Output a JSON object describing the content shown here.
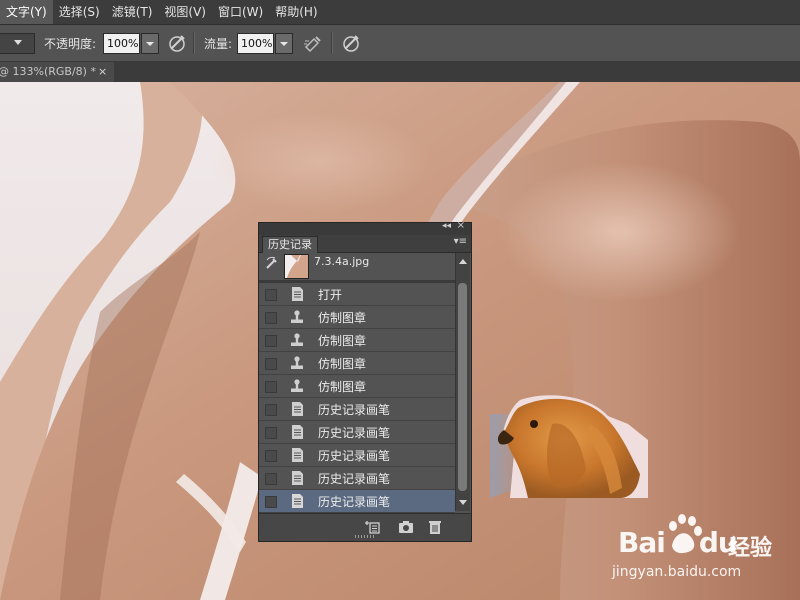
{
  "menubar": {
    "items": [
      {
        "label": "文字(Y)",
        "active": true
      },
      {
        "label": "选择(S)",
        "active": false
      },
      {
        "label": "滤镜(T)",
        "active": false
      },
      {
        "label": "视图(V)",
        "active": false
      },
      {
        "label": "窗口(W)",
        "active": false
      },
      {
        "label": "帮助(H)",
        "active": false
      }
    ]
  },
  "options": {
    "opacity_label": "不透明度:",
    "opacity_value": "100%",
    "flow_label": "流量:",
    "flow_value": "100%"
  },
  "document_tab": {
    "title": "@ 133%(RGB/8) *",
    "close": "×"
  },
  "history_panel": {
    "tab_label": "历史记录",
    "collapse_glyph": "◂◂",
    "close_glyph": "×",
    "menu_glyph": "▾≡",
    "snapshot_label": "7.3.4a.jpg",
    "states": [
      {
        "label": "打开",
        "icon": "document-icon",
        "selected": false
      },
      {
        "label": "仿制图章",
        "icon": "stamp-icon",
        "selected": false
      },
      {
        "label": "仿制图章",
        "icon": "stamp-icon",
        "selected": false
      },
      {
        "label": "仿制图章",
        "icon": "stamp-icon",
        "selected": false
      },
      {
        "label": "仿制图章",
        "icon": "stamp-icon",
        "selected": false
      },
      {
        "label": "历史记录画笔",
        "icon": "document-icon",
        "selected": false
      },
      {
        "label": "历史记录画笔",
        "icon": "document-icon",
        "selected": false
      },
      {
        "label": "历史记录画笔",
        "icon": "document-icon",
        "selected": false
      },
      {
        "label": "历史记录画笔",
        "icon": "document-icon",
        "selected": false
      },
      {
        "label": "历史记录画笔",
        "icon": "document-icon",
        "selected": true
      }
    ],
    "footer_icons": [
      "new-document-from-state-icon",
      "camera-icon",
      "trash-icon"
    ]
  },
  "watermark": {
    "logo": "Bai",
    "logo_tail": "du",
    "cn": "经验",
    "url": "jingyan.baidu.com"
  },
  "colors": {
    "ui_dark": "#3c3c3c",
    "ui_mid": "#535353",
    "selected_row": "#5b6a80",
    "skin": "#c99a80"
  }
}
